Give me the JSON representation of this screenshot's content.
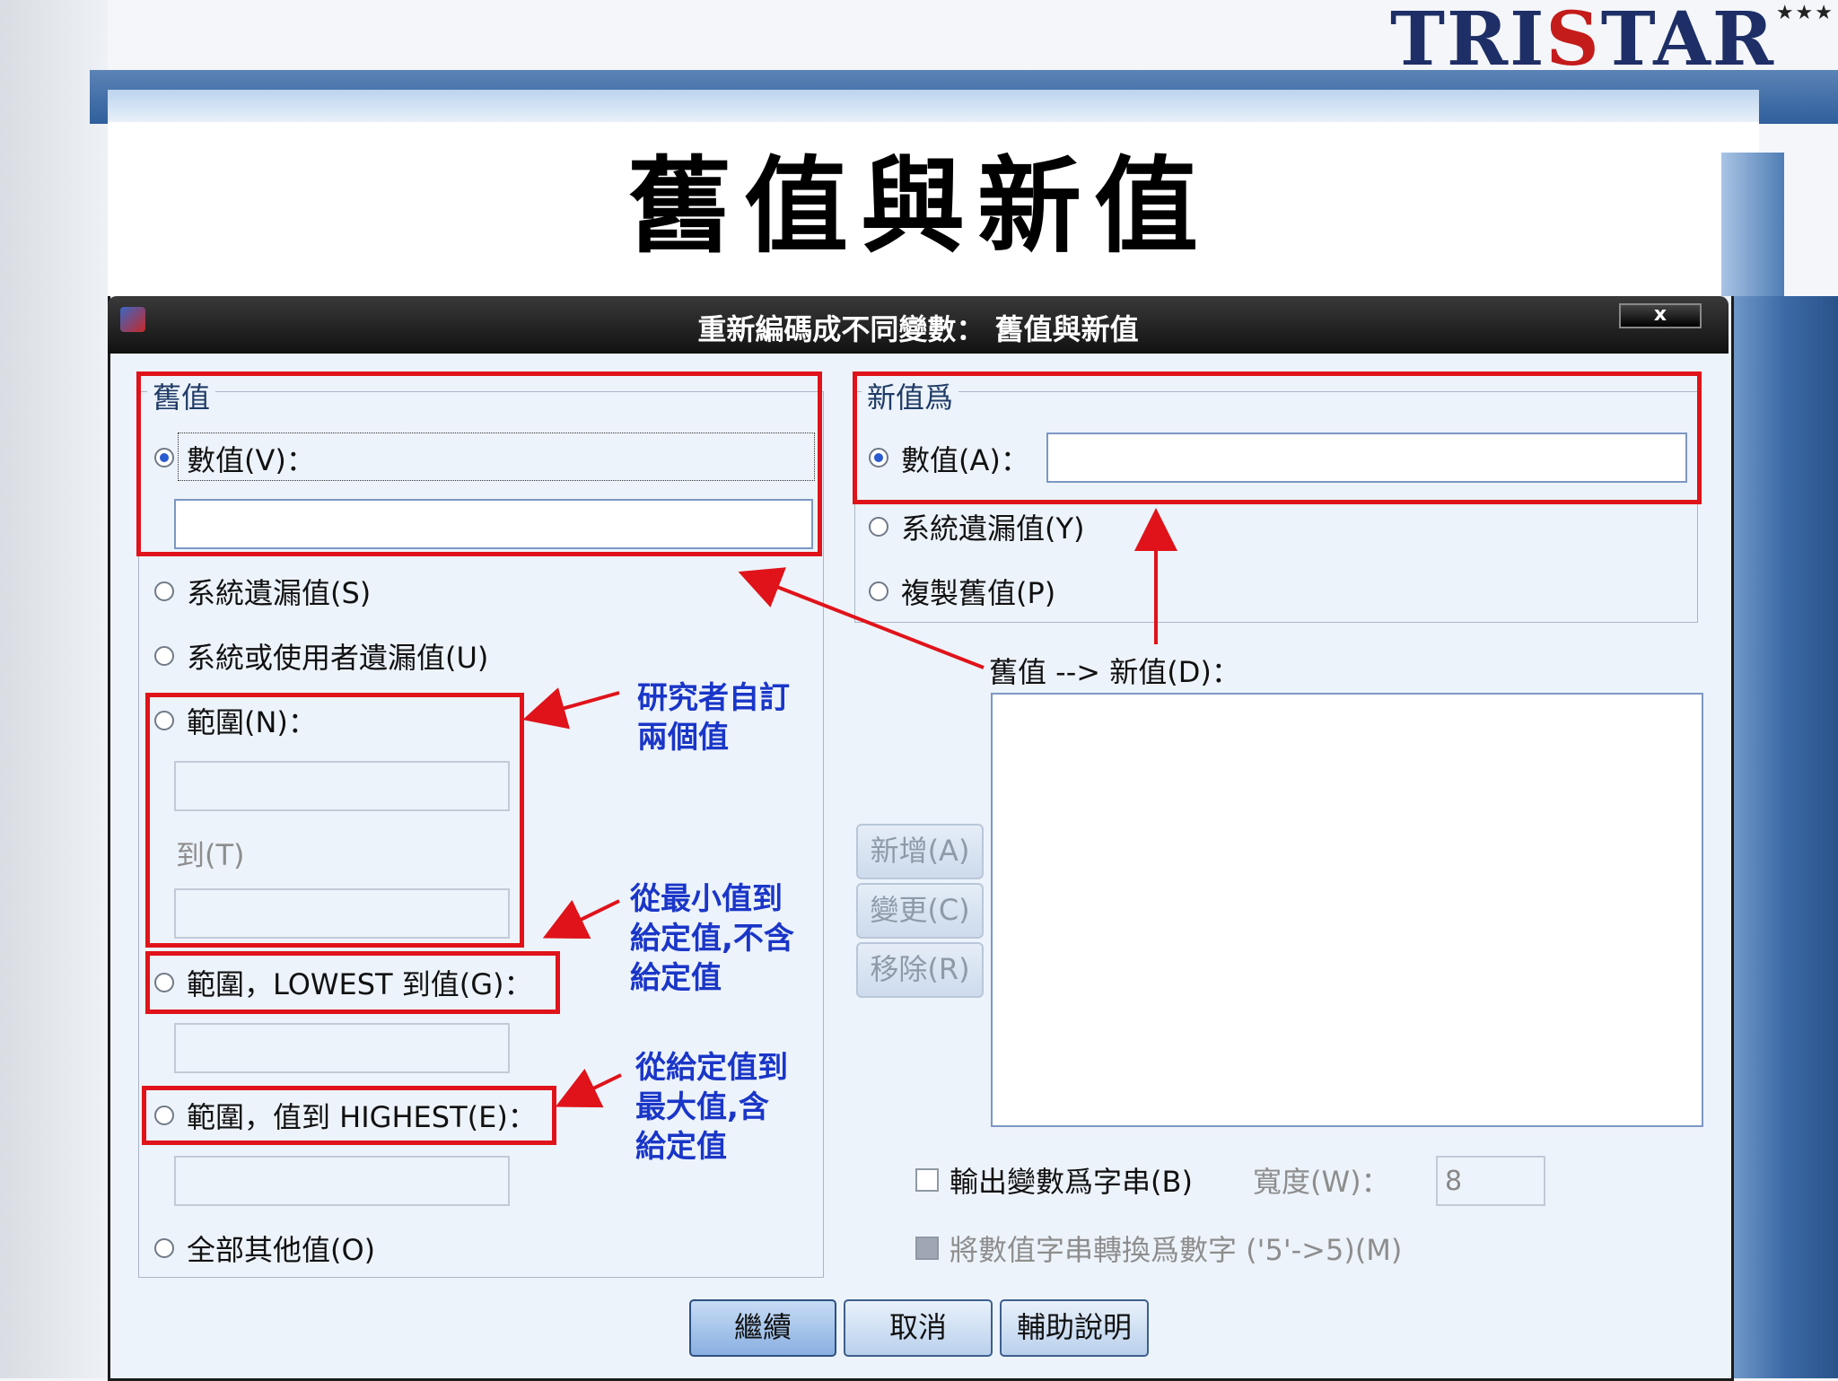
{
  "slide": {
    "title": "舊值與新值",
    "logo": {
      "prefix": "TRI",
      "accent": "S",
      "suffix": "TAR",
      "stars": "★★★"
    }
  },
  "dialog": {
    "title": "重新編碼成不同變數： 舊值與新值",
    "close_label": "x",
    "old_value": {
      "legend": "舊值",
      "value_label": "數值(V)：",
      "value_input": "",
      "system_missing_label": "系統遺漏值(S)",
      "system_or_user_missing_label": "系統或使用者遺漏值(U)",
      "range_label": "範圍(N)：",
      "range_from": "",
      "range_to_label": "到(T)",
      "range_to": "",
      "range_lowest_label": "範圍，LOWEST 到值(G)：",
      "range_lowest": "",
      "range_highest_label": "範圍，值到 HIGHEST(E)：",
      "range_highest": "",
      "all_other_label": "全部其他值(O)"
    },
    "new_value": {
      "legend": "新值爲",
      "value_label": "數值(A)：",
      "value_input": "",
      "system_missing_label": "系統遺漏值(Y)",
      "copy_old_label": "複製舊值(P)"
    },
    "old_new_list_label": "舊值 --> 新值(D)：",
    "buttons": {
      "add": "新增(A)",
      "change": "變更(C)",
      "remove": "移除(R)",
      "continue": "繼續",
      "cancel": "取消",
      "help": "輔助說明"
    },
    "output_string_label": "輸出變數爲字串(B)",
    "width_label": "寬度(W)：",
    "width_value": "8",
    "convert_numeric_label": "將數值字串轉換爲數字 ('5'->5)(M)"
  },
  "annotations": {
    "note_range": [
      "研究者自訂",
      "兩個值"
    ],
    "note_lowest": [
      "從最小值到",
      "給定值,不含",
      "給定值"
    ],
    "note_highest": [
      "從給定值到",
      "最大值,含",
      "給定值"
    ]
  },
  "colors": {
    "annotation_red": "#e0131a",
    "annotation_blue": "#1a36c8",
    "title_bar": "#111111"
  }
}
